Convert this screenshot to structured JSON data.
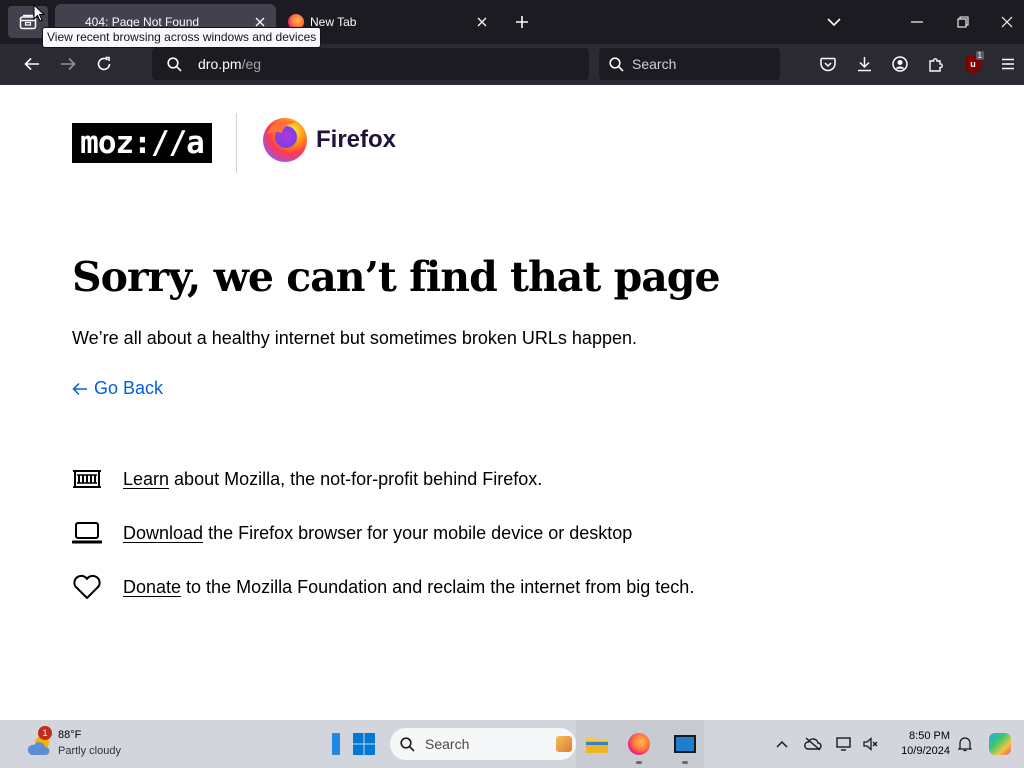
{
  "tabs": [
    {
      "title": "404: Page Not Found",
      "active": true
    },
    {
      "title": "New Tab",
      "active": false
    }
  ],
  "tooltip": "View recent browsing across windows and devices",
  "url": {
    "host": "dro.pm",
    "path": "/eg"
  },
  "search": {
    "placeholder": "Search"
  },
  "extension_badge": "1",
  "page": {
    "logo_mozilla": "moz://a",
    "logo_firefox": "Firefox",
    "headline": "Sorry, we can’t find that page",
    "lead": "We’re all about a healthy internet but sometimes broken URLs happen.",
    "go_back": "Go Back",
    "items": [
      {
        "link": "Learn",
        "text": " about Mozilla, the not-for-profit behind Firefox.",
        "icon": "museum-icon"
      },
      {
        "link": "Download",
        "text": " the Firefox browser for your mobile device or desktop",
        "icon": "laptop-icon"
      },
      {
        "link": "Donate",
        "text": " to the Mozilla Foundation and reclaim the internet from big tech.",
        "icon": "heart-icon"
      }
    ]
  },
  "taskbar": {
    "weather_temp": "88°F",
    "weather_desc": "Partly cloudy",
    "weather_badge": "1",
    "search_label": "Search",
    "time": "8:50 PM",
    "date": "10/9/2024"
  },
  "colors": {
    "tab_bar": "#1c1b22",
    "toolbar": "#2b2a33",
    "link_blue": "#0060df",
    "taskbar": "#d2d6dc"
  }
}
